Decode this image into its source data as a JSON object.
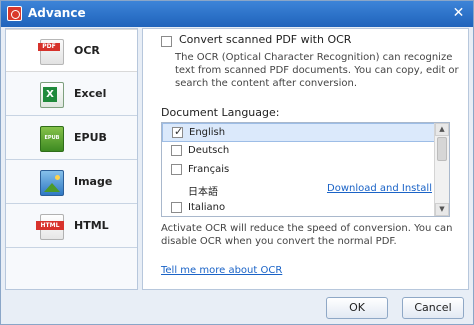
{
  "window": {
    "title": "Advance",
    "close_glyph": "✕"
  },
  "sidebar": {
    "items": [
      {
        "label": "OCR",
        "icon": "pdf-icon",
        "active": true
      },
      {
        "label": "Excel",
        "icon": "excel-icon",
        "active": false
      },
      {
        "label": "EPUB",
        "icon": "epub-icon",
        "active": false
      },
      {
        "label": "Image",
        "icon": "image-icon",
        "active": false
      },
      {
        "label": "HTML",
        "icon": "html-icon",
        "active": false
      }
    ]
  },
  "ocr": {
    "checkbox_label": "Convert scanned PDF with OCR",
    "checked": false,
    "description": "The OCR (Optical Character Recognition) can recognize text from scanned PDF documents. You can copy, edit or search the content after conversion."
  },
  "language": {
    "heading": "Document Language:",
    "options": [
      {
        "name": "English",
        "checked": true,
        "selected": true
      },
      {
        "name": "Deutsch",
        "checked": false
      },
      {
        "name": "Français",
        "checked": false
      },
      {
        "name": "日本語",
        "action": "Download and Install"
      },
      {
        "name": "Italiano",
        "checked": false
      }
    ]
  },
  "note": "Activate OCR will reduce the speed of conversion. You can disable OCR when you convert the normal PDF.",
  "more_link": "Tell me more about OCR",
  "buttons": {
    "ok": "OK",
    "cancel": "Cancel"
  },
  "colors": {
    "titlebar": "#2b6fc9",
    "link": "#1a63c7",
    "selection": "#dbe9fb"
  }
}
